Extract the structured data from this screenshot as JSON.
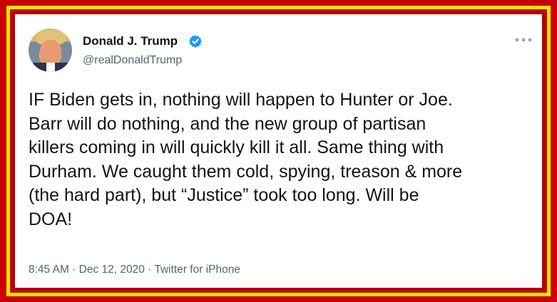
{
  "tweet": {
    "display_name": "Donald J. Trump",
    "handle": "@realDonaldTrump",
    "text": "IF Biden gets in, nothing will happen to Hunter or Joe.\nBarr will do nothing, and the new group of partisan\nkillers coming in will quickly kill it all. Same thing with\nDurham. We caught them cold, spying, treason & more\n(the hard part), but “Justice” took too long. Will be\nDOA!",
    "meta": "8:45 AM · Dec 12, 2020 · Twitter for iPhone"
  },
  "icons": {
    "verified": "verified-badge-icon",
    "more": "more-options-icon",
    "avatar": "profile-avatar"
  },
  "colors": {
    "frame_red": "#c80000",
    "frame_yellow": "#f5e600",
    "verified_blue": "#1d9bf0",
    "text": "#0f1419",
    "secondary_text": "#536471"
  }
}
